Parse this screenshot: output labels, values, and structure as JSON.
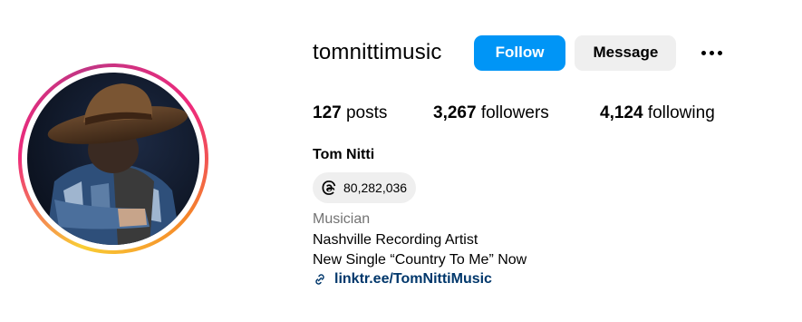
{
  "profile": {
    "username": "tomnittimusic",
    "follow_label": "Follow",
    "message_label": "Message",
    "more_icon": "more-options-icon",
    "stats": {
      "posts_count": "127",
      "posts_label": "posts",
      "followers_count": "3,267",
      "followers_label": "followers",
      "following_count": "4,124",
      "following_label": "following"
    },
    "full_name": "Tom Nitti",
    "threads_icon": "threads-icon",
    "threads_count": "80,282,036",
    "category": "Musician",
    "bio_line1": "Nashville Recording Artist",
    "bio_line2": "New Single “Country To Me” Now",
    "link_icon": "link-icon",
    "link_text": "linktr.ee/TomNittiMusic"
  },
  "colors": {
    "follow_button": "#0095f6",
    "message_button": "#efefef",
    "link": "#00376b",
    "category_text": "#737373"
  }
}
